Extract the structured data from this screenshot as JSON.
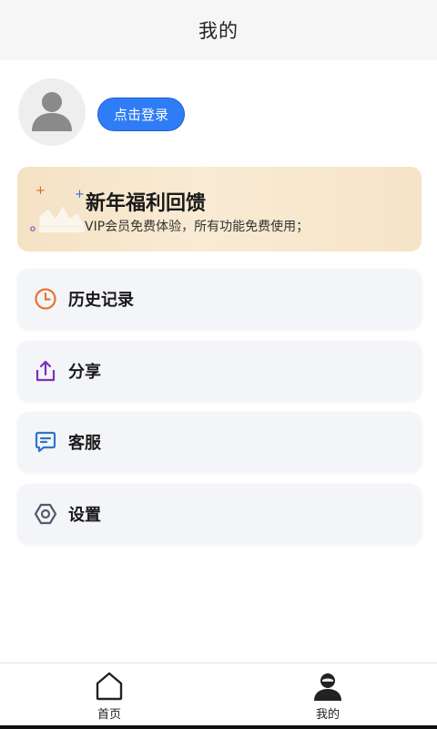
{
  "header": {
    "title": "我的"
  },
  "profile": {
    "avatar_icon": "user-avatar-icon",
    "login_label": "点击登录"
  },
  "promo": {
    "title": "新年福利回馈",
    "subtitle": "VIP会员免费体验，所有功能免费使用；"
  },
  "menu": [
    {
      "label": "历史记录",
      "icon": "clock-icon",
      "color": "#e8742e"
    },
    {
      "label": "分享",
      "icon": "share-icon",
      "color": "#7b2fbf"
    },
    {
      "label": "客服",
      "icon": "chat-icon",
      "color": "#2f76c6"
    },
    {
      "label": "设置",
      "icon": "settings-icon",
      "color": "#555a6a"
    }
  ],
  "bottom_nav": [
    {
      "label": "首页",
      "icon": "home-icon"
    },
    {
      "label": "我的",
      "icon": "profile-icon"
    }
  ],
  "colors": {
    "accent": "#2f7df6",
    "promo_bg": "#f4e2c4"
  }
}
